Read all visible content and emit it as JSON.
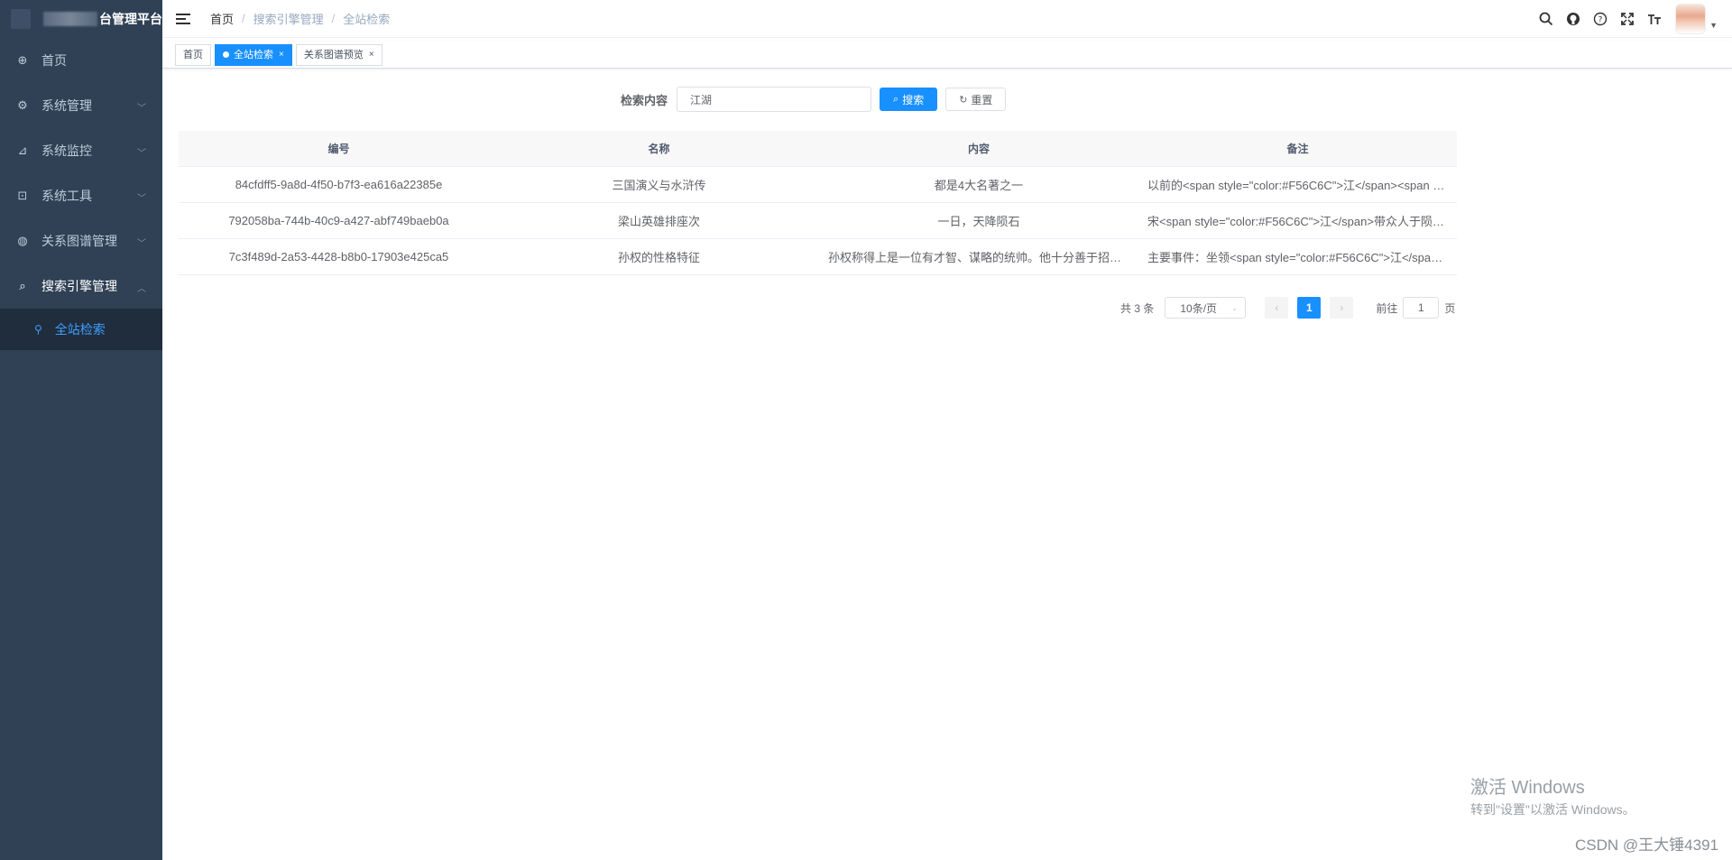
{
  "app": {
    "title": "台管理平台"
  },
  "sidebar": {
    "items": [
      {
        "label": "首页",
        "icon": "dashboard-icon",
        "glyph": "⊕"
      },
      {
        "label": "系统管理",
        "icon": "gear-icon",
        "glyph": "⚙"
      },
      {
        "label": "系统监控",
        "icon": "monitor-icon",
        "glyph": "⊿"
      },
      {
        "label": "系统工具",
        "icon": "tool-icon",
        "glyph": "⊡"
      },
      {
        "label": "关系图谱管理",
        "icon": "globe-icon",
        "glyph": "◍"
      },
      {
        "label": "搜索引擎管理",
        "icon": "search-icon",
        "glyph": "⌕"
      }
    ],
    "submenu": {
      "label": "全站检索",
      "icon": "pin-icon",
      "glyph": "⚲"
    }
  },
  "navbar": {
    "breadcrumb": [
      "首页",
      "搜索引擎管理",
      "全站检索"
    ]
  },
  "tags": [
    {
      "label": "首页",
      "active": false,
      "closable": false
    },
    {
      "label": "全站检索",
      "active": true,
      "closable": true
    },
    {
      "label": "关系图谱预览",
      "active": false,
      "closable": true
    }
  ],
  "search": {
    "label": "检索内容",
    "value": "江湖",
    "search_button": "搜索",
    "reset_button": "重置"
  },
  "table": {
    "columns": [
      "编号",
      "名称",
      "内容",
      "备注"
    ],
    "rows": [
      [
        "84cfdff5-9a8d-4f50-b7f3-ea616a22385e",
        "三国演义与水浒传",
        "都是4大名著之一",
        "以前的<span style=\"color:#F56C6C\">江</span><span style=\"color:#F56C6C\">湖</span>"
      ],
      [
        "792058ba-744b-40c9-a427-abf749baeb0a",
        "梁山英雄排座次",
        "一日，天降陨石",
        "宋<span style=\"color:#F56C6C\">江</span>带众人于陨落之地"
      ],
      [
        "7c3f489d-2a53-4428-b8b0-17903e425ca5",
        "孙权的性格特征",
        "孙权称得上是一位有才智、谋略的统帅。他十分善于招揽人才",
        "主要事件：坐领<span style=\"color:#F56C6C\">江</span>东"
      ]
    ]
  },
  "pagination": {
    "total": "共 3 条",
    "page_size": "10条/页",
    "current": "1",
    "goto_label": "前往",
    "goto_value": "1",
    "page_unit": "页",
    "prev": "‹",
    "next": "›"
  },
  "watermark": {
    "title": "激活 Windows",
    "subtitle": "转到\"设置\"以激活 Windows。"
  },
  "credit": "CSDN @王大锤4391",
  "colors": {
    "sidebar": "#304156",
    "primary": "#1890ff",
    "sub_menu": "#1f2d3d"
  }
}
